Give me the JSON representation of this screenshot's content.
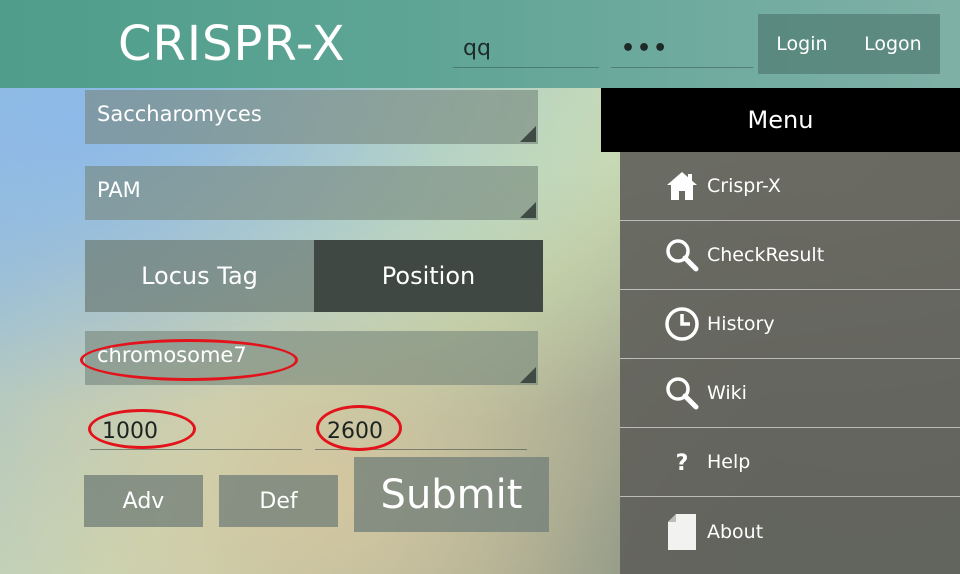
{
  "header": {
    "app_title": "CRISPR-X",
    "username_value": "qq",
    "password_value": "•••",
    "login_label": "Login",
    "logon_label": "Logon"
  },
  "form": {
    "species_value": "Saccharomyces",
    "pam_value": "PAM",
    "mode_tabs": [
      {
        "label": "Locus Tag",
        "selected": false
      },
      {
        "label": "Position",
        "selected": true
      }
    ],
    "chromosome_value": "chromosome7",
    "start_value": "1000",
    "end_value": "2600",
    "adv_label": "Adv",
    "def_label": "Def",
    "submit_label": "Submit"
  },
  "menu": {
    "title": "Menu",
    "items": [
      {
        "label": "Crispr-X",
        "icon": "home-icon"
      },
      {
        "label": "CheckResult",
        "icon": "search-icon"
      },
      {
        "label": "History",
        "icon": "clock-icon"
      },
      {
        "label": "Wiki",
        "icon": "search-icon"
      },
      {
        "label": "Help",
        "icon": "question-icon"
      },
      {
        "label": "About",
        "icon": "document-icon"
      }
    ]
  },
  "colors": {
    "header_teal": "#4f9d8a",
    "annotation_red": "#e3131b",
    "selected_tab": "#3f4843",
    "menu_header": "#000000"
  }
}
